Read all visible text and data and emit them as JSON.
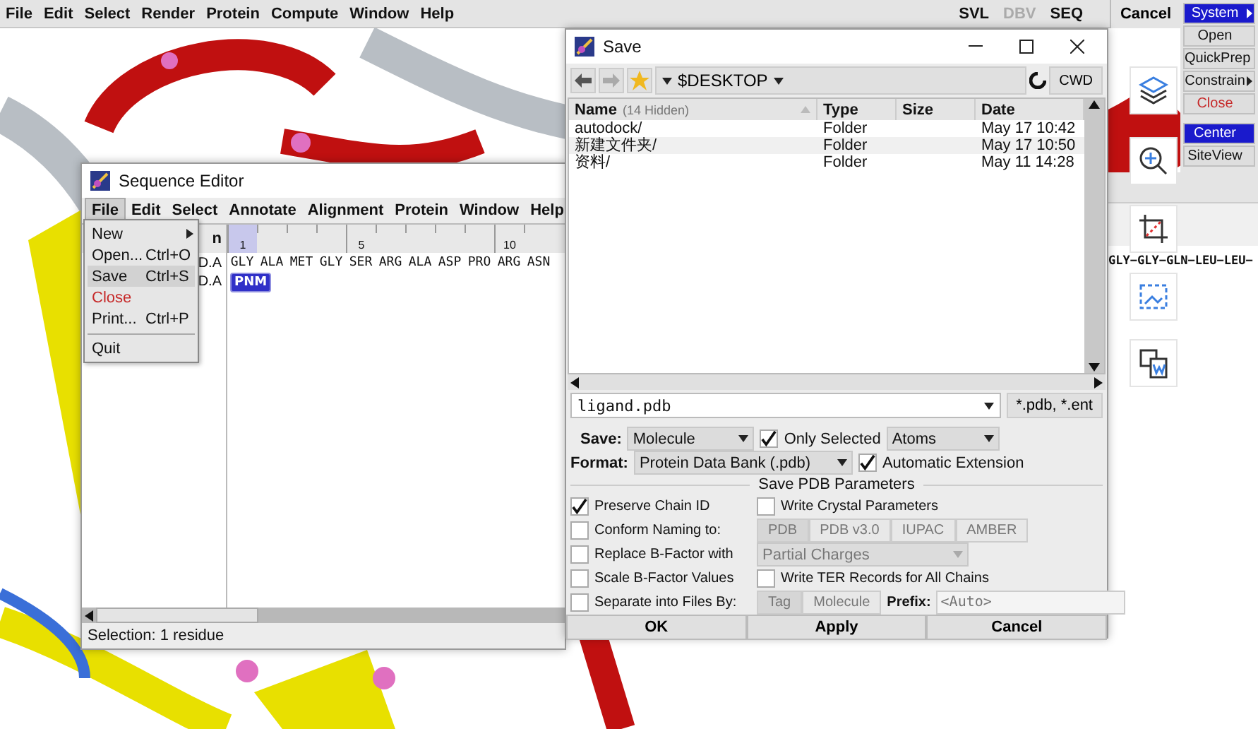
{
  "main_menu": [
    "File",
    "Edit",
    "Select",
    "Render",
    "Protein",
    "Compute",
    "Window",
    "Help"
  ],
  "main_tools": [
    {
      "label": "SVL",
      "disabled": false
    },
    {
      "label": "DBV",
      "disabled": true
    },
    {
      "label": "SEQ",
      "disabled": false
    }
  ],
  "main_cancel": "Cancel",
  "right_panel": [
    {
      "label": "System",
      "kind": "primary",
      "submenu": true
    },
    {
      "label": "Open",
      "kind": "normal",
      "submenu": false
    },
    {
      "label": "QuickPrep",
      "kind": "normal",
      "submenu": false
    },
    {
      "label": "Constrain",
      "kind": "normal",
      "submenu": true
    },
    {
      "label": "Close",
      "kind": "danger",
      "submenu": false
    },
    {
      "label": "Center",
      "kind": "primary",
      "submenu": false
    },
    {
      "label": "SiteView",
      "kind": "normal",
      "submenu": false
    }
  ],
  "background_sequence": "GLY−GLY−GLN−LEU−LEU−",
  "sequence_editor": {
    "title": "Sequence Editor",
    "menu": [
      {
        "label": "File",
        "selected": true
      },
      {
        "label": "Edit",
        "selected": false
      },
      {
        "label": "Select",
        "selected": false
      },
      {
        "label": "Annotate",
        "selected": false
      },
      {
        "label": "Alignment",
        "selected": false
      },
      {
        "label": "Protein",
        "selected": false
      },
      {
        "label": "Window",
        "selected": false
      },
      {
        "label": "Help",
        "selected": false
      }
    ],
    "name_header": "n",
    "chain_labels": [
      "D.A",
      "D.A"
    ],
    "residues": [
      {
        "name": "GLY",
        "ruler": "1",
        "selected": true
      },
      {
        "name": "ALA"
      },
      {
        "name": "MET"
      },
      {
        "name": "GLY"
      },
      {
        "name": "SER",
        "ruler": "5",
        "selected": false
      },
      {
        "name": "ARG"
      },
      {
        "name": "ALA"
      },
      {
        "name": "ASP"
      },
      {
        "name": "PRO"
      },
      {
        "name": "ARG",
        "ruler": "10",
        "selected": false
      },
      {
        "name": "ASN"
      }
    ],
    "ligand": {
      "name": "PNM",
      "selected": true
    },
    "status": "Selection:  1 residue"
  },
  "file_menu": [
    {
      "label": "New",
      "submenu": true,
      "kind": "item",
      "selected": false,
      "separator_before": false
    },
    {
      "label": "Open...",
      "shortcut": "Ctrl+O",
      "submenu": false,
      "kind": "item",
      "selected": false,
      "separator_before": false
    },
    {
      "label": "Save",
      "shortcut": "Ctrl+S",
      "submenu": false,
      "kind": "item",
      "selected": true,
      "separator_before": false
    },
    {
      "label": "Close",
      "submenu": false,
      "kind": "danger",
      "selected": false,
      "separator_before": false
    },
    {
      "label": "Print...",
      "shortcut": "Ctrl+P",
      "submenu": false,
      "kind": "item",
      "selected": false,
      "separator_before": false
    },
    {
      "label": "Quit",
      "submenu": false,
      "kind": "item",
      "selected": false,
      "separator_before": true
    }
  ],
  "save_dialog": {
    "title": "Save",
    "path": "$DESKTOP",
    "cwd": "CWD",
    "columns": [
      {
        "label": "Name",
        "note": "(14 Hidden)",
        "sorted": true
      },
      {
        "label": "Type",
        "sorted": false
      },
      {
        "label": "Size",
        "sorted": false
      },
      {
        "label": "Date",
        "sorted": false
      }
    ],
    "rows": [
      {
        "name": "autodock/",
        "type": "Folder",
        "date": "May 17 10:42"
      },
      {
        "name": "新建文件夹/",
        "type": "Folder",
        "date": "May 17 10:50"
      },
      {
        "name": "资料/",
        "type": "Folder",
        "date": "May 11 14:28"
      }
    ],
    "filename": "ligand.pdb",
    "filter": "*.pdb, *.ent",
    "save_label": "Save:",
    "save_value": "Molecule",
    "only_selected": {
      "label": "Only Selected",
      "checked": true
    },
    "selected_of": "Atoms",
    "format_label": "Format:",
    "format_value": "Protein Data Bank (.pdb)",
    "auto_extension": {
      "label": "Automatic Extension",
      "checked": true
    },
    "section_title": "Save PDB Parameters",
    "parameter_rows": [
      [
        {
          "kind": "checkbox",
          "label": "Preserve Chain ID",
          "checked": true
        },
        {
          "kind": "checkbox",
          "label": "Write Crystal Parameters",
          "checked": false
        }
      ],
      [
        {
          "kind": "checkbox",
          "label": "Conform Naming to:",
          "checked": false
        },
        {
          "kind": "segmented",
          "disabled": true,
          "options": [
            {
              "label": "PDB",
              "selected": true
            },
            {
              "label": "PDB v3.0",
              "selected": false
            },
            {
              "label": "IUPAC",
              "selected": false
            },
            {
              "label": "AMBER",
              "selected": false
            }
          ]
        }
      ],
      [
        {
          "kind": "checkbox",
          "label": "Replace B-Factor with",
          "checked": false
        },
        {
          "kind": "dropdown",
          "disabled": true,
          "value": "Partial Charges"
        }
      ],
      [
        {
          "kind": "checkbox",
          "label": "Scale B-Factor Values",
          "checked": false
        },
        {
          "kind": "checkbox",
          "label": "Write TER Records for All Chains",
          "checked": false
        }
      ],
      [
        {
          "kind": "checkbox",
          "label": "Separate into Files By:",
          "checked": false
        },
        {
          "kind": "segmented",
          "disabled": true,
          "options": [
            {
              "label": "Tag",
              "selected": true
            },
            {
              "label": "Molecule",
              "selected": false
            }
          ]
        },
        {
          "kind": "field",
          "label": "Prefix:",
          "placeholder": "<Auto>"
        }
      ]
    ],
    "buttons": [
      "OK",
      "Apply",
      "Cancel"
    ]
  }
}
